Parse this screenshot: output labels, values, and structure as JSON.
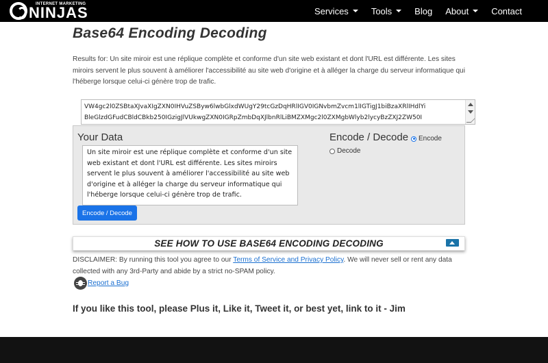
{
  "nav": {
    "logo_small": "INTERNET MARKETING",
    "logo_big": "NINJAS",
    "items": [
      {
        "label": "Services",
        "dropdown": true
      },
      {
        "label": "Tools",
        "dropdown": true
      },
      {
        "label": "Blog",
        "dropdown": false
      },
      {
        "label": "About",
        "dropdown": true
      },
      {
        "label": "Contact",
        "dropdown": false
      }
    ]
  },
  "page": {
    "title": "Base64 Encoding Decoding",
    "results": "Results for: Un site miroir est une réplique complète et conforme d'un site web existant et dont l'URL est différente. Les sites miroirs servent le plus souvent à améliorer l'accessibilité au site web d'origine et à alléger la charge du serveur informatique qui l'héberge lorsque celui-ci génère trop de trafic."
  },
  "output": {
    "line1": "VW4gc2l0ZSBtaXJvaXIgZXN0IHVuZSByw6lwbGlxdWUgY29tcGzDqHRlIGV0IGNvbmZvcm1lIGTigJ1biBzaXRlIHdlYi",
    "line2": "BleGlzdGFudCBldCBkb250IGzigJlVUkwgZXN0IGRpZmbDqXJlbnRlLiBMZXMgc2l0ZXMgbWlyb2lycyBzZXJ2ZW50I"
  },
  "tool": {
    "your_data_label": "Your Data",
    "input_value": "Un site miroir est une réplique complète et conforme d'un site web existant et dont l'URL est différente. Les sites miroirs servent le plus souvent à améliorer l'accessibilité au site web d'origine et à alléger la charge du serveur informatique qui l'héberge lorsque celui-ci génère trop de trafic.",
    "button_label": "Encode / Decode",
    "mode_title": "Encode / Decode",
    "encode_label": "Encode",
    "decode_label": "Decode"
  },
  "howto": {
    "label": "SEE HOW TO USE BASE64 ENCODING DECODING"
  },
  "disclaimer": {
    "prefix": "DISCLAIMER: By running this tool you agree to our ",
    "link": "Terms of Service and Privacy Policy",
    "suffix": ". We will never sell or rent any data collected with any 3rd-Party and abide by a strict no-SPAM policy."
  },
  "bug": {
    "label": "Report a Bug"
  },
  "cta": {
    "text": "If you like this tool, please Plus it, Like it, Tweet it, or best yet, link to it - Jim"
  }
}
